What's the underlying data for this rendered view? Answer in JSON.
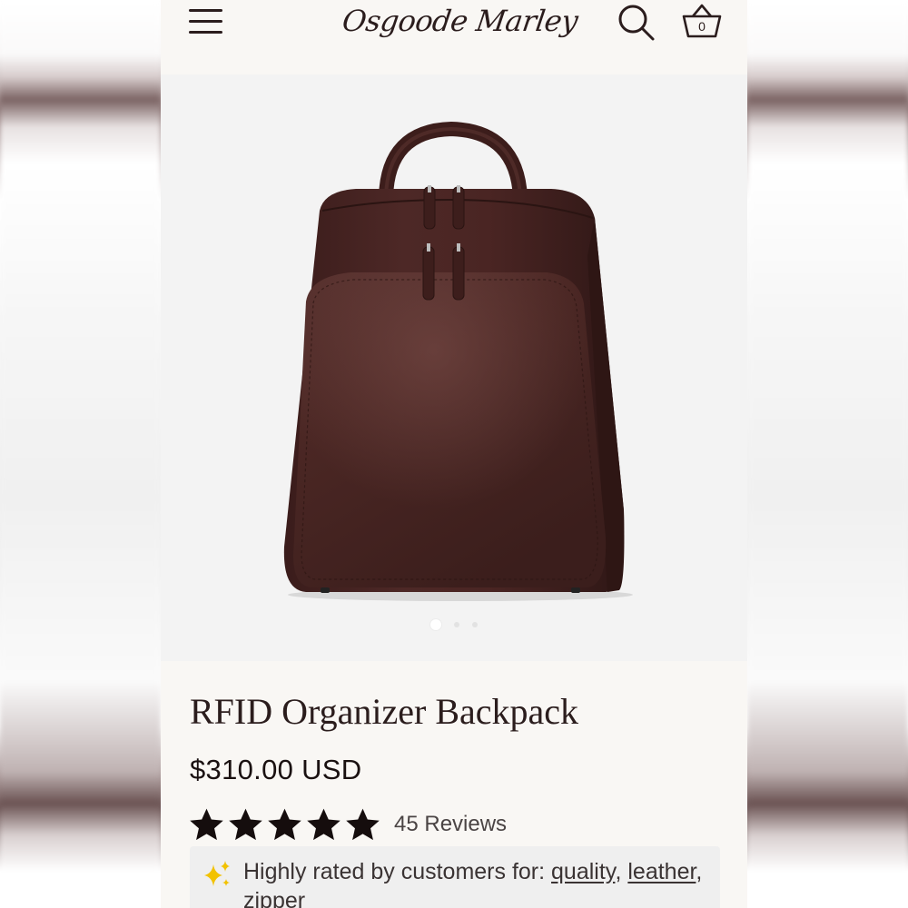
{
  "header": {
    "logo_text": "Osgoode Marley",
    "cart_count": "0",
    "icons": [
      "hamburger-menu-icon",
      "search-icon",
      "basket-icon"
    ]
  },
  "gallery": {
    "image_subject": "dark brown leather backpack",
    "slide_count": 3,
    "active_slide": 1
  },
  "product": {
    "title": "RFID Organizer Backpack",
    "price": "$310.00 USD",
    "rating_stars": 5,
    "reviews_label": "45 Reviews",
    "highlight_prefix": "Highly rated by customers for:",
    "highlight_tags": [
      "quality",
      "leather",
      "zipper"
    ],
    "highlight_sep_1": ",",
    "highlight_sep_2": ","
  },
  "colors": {
    "brand_dark": "#2b1d1d",
    "leather_brown": "#4a2624",
    "sparkle_yellow": "#f2c200"
  }
}
